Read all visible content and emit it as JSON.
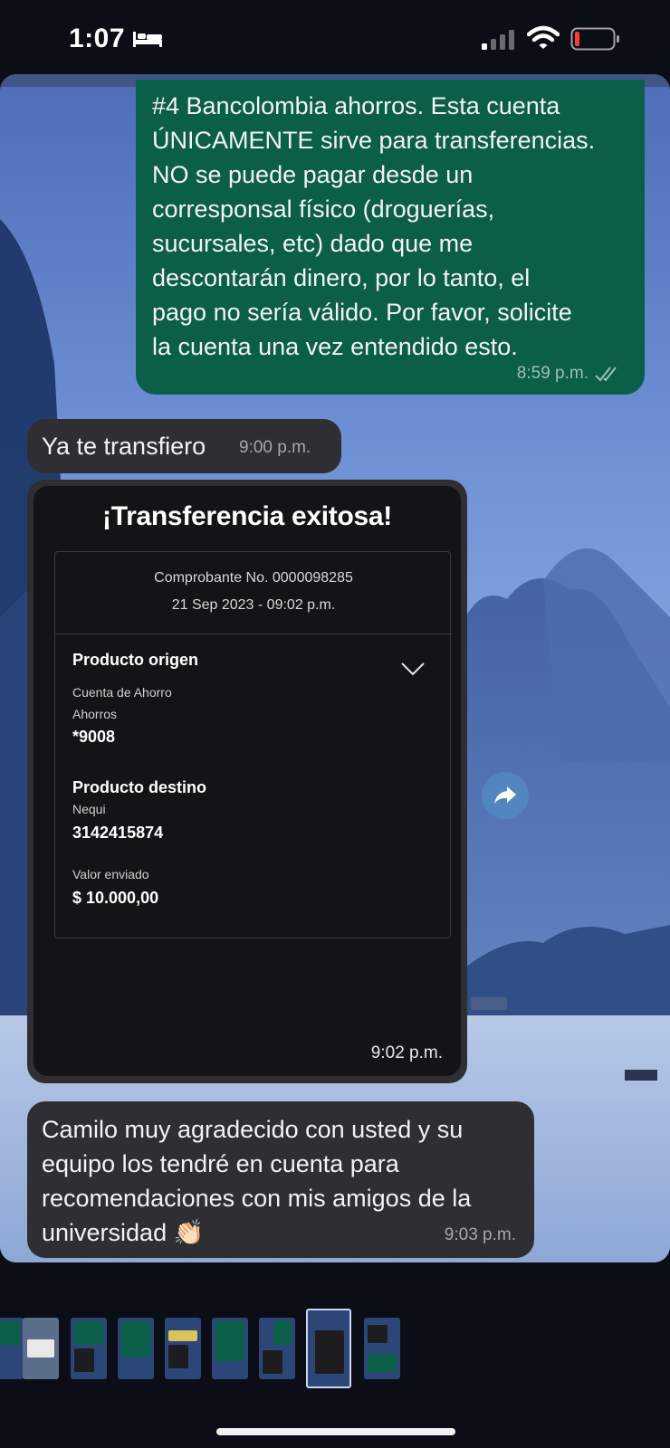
{
  "status_bar": {
    "time": "1:07",
    "icons": [
      "bed-icon",
      "signal-icon",
      "wifi-icon",
      "battery-icon"
    ],
    "battery_color": "#ff3b30"
  },
  "messages": [
    {
      "direction": "outgoing",
      "lines": [
        "#4 Bancolombia ahorros. Esta cuenta",
        "ÚNICAMENTE sirve para transferencias.",
        "NO se puede pagar desde un",
        "corresponsal físico (droguerías,",
        "sucursales, etc)  dado que me",
        "descontarán dinero, por lo tanto, el",
        "pago no sería válido. Por favor, solicite",
        "la cuenta una vez entendido esto."
      ],
      "time": "8:59 p.m."
    },
    {
      "direction": "incoming",
      "text": "Ya te transfiero",
      "time": "9:00 p.m."
    },
    {
      "direction": "incoming",
      "type": "image",
      "time": "9:02 p.m.",
      "receipt": {
        "title": "¡Transferencia exitosa!",
        "voucher": "Comprobante No. 0000098285",
        "datetime": "21 Sep 2023 - 09:02 p.m.",
        "origin_heading": "Producto origen",
        "origin_type": "Cuenta de Ahorro",
        "origin_subtype": "Ahorros",
        "origin_account": "*9008",
        "destination_heading": "Producto destino",
        "destination_name": "Nequi",
        "destination_number": "3142415874",
        "amount_label": "Valor enviado",
        "amount": "$ 10.000,00"
      }
    },
    {
      "direction": "incoming",
      "lines": [
        "Camilo muy agradecido con usted y su",
        "equipo los tendré en cuenta para",
        "recomendaciones con mis amigos de la",
        "universidad 👏🏻"
      ],
      "time": "9:03 p.m."
    }
  ],
  "colors": {
    "outgoing_bubble": "#0b5e47",
    "incoming_bubble": "#2f2f33",
    "background": "#0b0e16"
  },
  "thumbnail_count": 9,
  "active_thumbnail": 7
}
